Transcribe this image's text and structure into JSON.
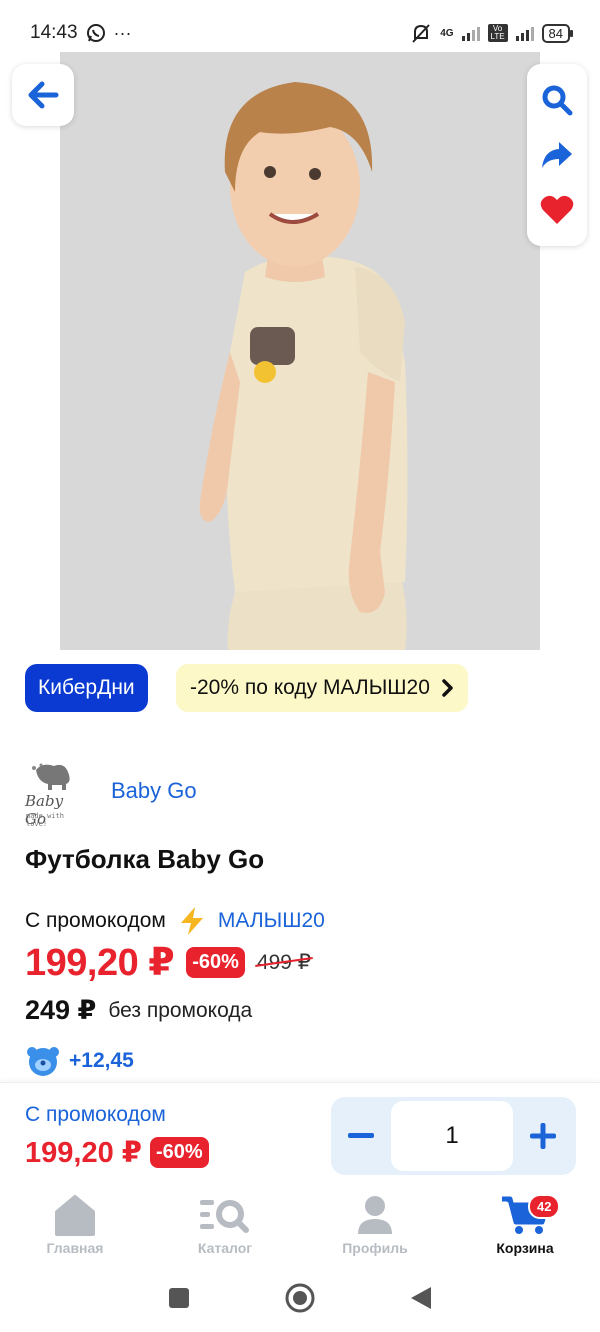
{
  "status_bar": {
    "time": "14:43",
    "network_label": "4G",
    "volte_label": "Vo LTE",
    "battery": "84"
  },
  "gallery": {
    "image_count": 5,
    "active_index": 0
  },
  "promo_chips": {
    "event": "КиберДни",
    "discount": "-20% по коду МАЛЫШ20"
  },
  "brand": {
    "name": "Baby Go",
    "logo_text": "Baby Go",
    "logo_tagline": "made with love!"
  },
  "product": {
    "title": "Футболка Baby Go"
  },
  "pricing": {
    "promo_label": "С промокодом",
    "promo_code": "МАЛЫШ20",
    "promo_price": "199,20 ₽",
    "discount_badge": "-60%",
    "old_price": "499 ₽",
    "regular_price": "249 ₽",
    "regular_price_label": "без промокода",
    "bonus": "+12,45"
  },
  "buy_panel": {
    "label": "С промокодом",
    "price": "199,20 ₽",
    "badge": "-60%",
    "quantity": "1"
  },
  "tabs": [
    {
      "label": "Главная",
      "icon": "home-icon"
    },
    {
      "label": "Каталог",
      "icon": "catalog-search-icon"
    },
    {
      "label": "Профиль",
      "icon": "profile-icon"
    },
    {
      "label": "Корзина",
      "icon": "cart-icon",
      "badge": "42",
      "active": true
    }
  ],
  "colors": {
    "accent_blue": "#1a63d8",
    "price_red": "#e8232e",
    "event_chip": "#0a3ad1",
    "promo_chip": "#fdf8c7"
  }
}
